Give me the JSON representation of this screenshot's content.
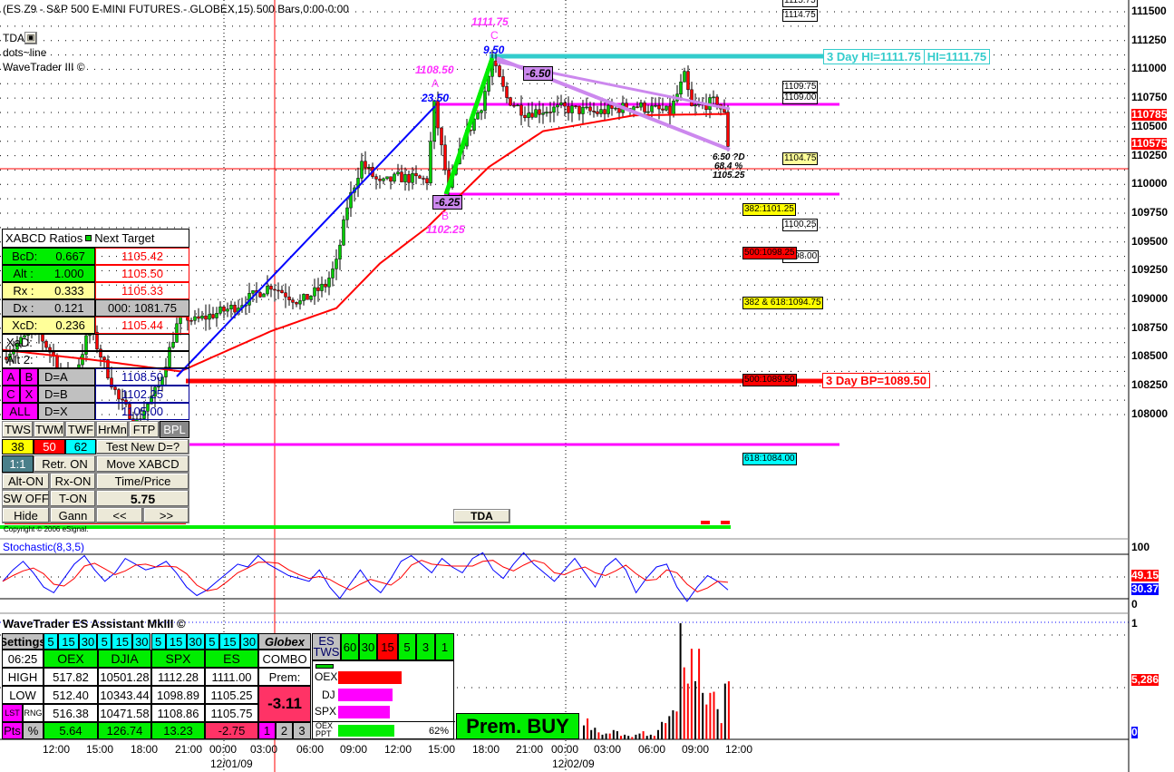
{
  "header": {
    "title": "(ES Z9 - S&P 500 E-MINI FUTURES - GLOBEX,15) 500 Bars,0:00-0:00",
    "tda": "TDA",
    "dots": "dots~line",
    "wavetrader": "WaveTrader III ©"
  },
  "colors": {
    "up": "#00cc00",
    "down": "#ff0000",
    "ma": "#ff0000",
    "abLine": "#0000ff",
    "bcLine": "#00ee00",
    "cdLine": "#cc88ee"
  },
  "price_axis": [
    "111500",
    "111250",
    "111000",
    "110750",
    "110500",
    "110250",
    "110000",
    "109750",
    "109500",
    "109250",
    "109000",
    "108750",
    "108500",
    "108250",
    "108000"
  ],
  "price_badges": {
    "last1": "110785",
    "last2": "110575"
  },
  "pattern": {
    "a_price": "1108.50",
    "a_label": "A",
    "a_move": "23.50",
    "b_price": "1102.25",
    "b_label": "B",
    "b_move": "-6.25",
    "c_price": "1111.75",
    "c_label": "C",
    "c_move": "9.50",
    "cd_move": "-6.50",
    "d_line1": "6.50 ?D",
    "d_line2": "68.4 %",
    "d_line3": "1105.25"
  },
  "levels": {
    "l1": "1115.75",
    "l2": "1114.75",
    "hi3": "3 Day HI=1111.75",
    "hi": "HI=1111.75",
    "l3": "1109.75",
    "l4": "1109.00",
    "l5": "1104.75",
    "f382": "382:1101.25",
    "l6": "1100.25",
    "f500": "500:1098.25",
    "l7": "1098.00",
    "f382618": "382 & 618:1094.75",
    "f500b": "500:1089.50",
    "bp3": "3 Day BP=1089.50",
    "f618": "618:1084.00"
  },
  "xabcd": {
    "title": "XABCD Ratios",
    "next": "Next Target",
    "rows": [
      {
        "k": "BcD:",
        "v": "0.667",
        "t": "1105.42"
      },
      {
        "k": "Alt  :",
        "v": "1.000",
        "t": "1105.50"
      },
      {
        "k": "Rx   :",
        "v": "0.333",
        "t": "1105.33"
      },
      {
        "k": "Dx   :",
        "v": "0.121",
        "t": "000: 1081.75"
      },
      {
        "k": "XcD:",
        "v": "0.236",
        "t": "1105.44"
      },
      {
        "k": "XaD:",
        "v": "",
        "t": ""
      },
      {
        "k": "Alt 2:",
        "v": "",
        "t": ""
      }
    ],
    "abcd": {
      "a": "A",
      "b": "B",
      "c": "C",
      "x": "X",
      "all": "ALL",
      "da": "D=A",
      "db": "D=B",
      "dx": "D=X",
      "ta": "1108.50",
      "tb": "1102.25",
      "tx": "1105.00"
    },
    "buttons": {
      "tws": "TWS",
      "twm": "TWM",
      "twf": "TWF",
      "hrmn": "HrMn",
      "ftp": "FTP",
      "bpl": "BPL",
      "f38": "38",
      "f50": "50",
      "f62": "62",
      "test": "Test New D=?",
      "ratio": "1:1",
      "retr": "Retr. ON",
      "move": "Move XABCD",
      "alt": "Alt-ON",
      "rx": "Rx-ON",
      "tp": "Time/Price",
      "sw": "SW OFF",
      "ton": "T-ON",
      "val": "5.75",
      "hide": "Hide",
      "gann": "Gann",
      "prev": "<<",
      "next": ">>"
    },
    "copyright": "Copyright © 2006 eSignal."
  },
  "tda_button": "TDA",
  "stoch": {
    "title": "Stochastic(8,3,5)",
    "axis_top": "100",
    "axis_bottom": "0",
    "k_val": "49.15",
    "d_val": "30.37",
    "k": [
      40,
      60,
      75,
      55,
      30,
      20,
      45,
      70,
      85,
      60,
      40,
      55,
      80,
      70,
      60,
      65,
      75,
      55,
      30,
      15,
      25,
      40,
      55,
      70,
      65,
      85,
      70,
      60,
      50,
      45,
      40,
      60,
      30,
      10,
      35,
      60,
      35,
      20,
      45,
      75,
      85,
      70,
      55,
      80,
      65,
      55,
      80,
      90,
      60,
      45,
      70,
      90,
      70,
      55,
      40,
      60,
      80,
      55,
      30,
      65,
      80,
      60,
      20,
      45,
      65,
      70,
      30,
      5,
      30,
      50,
      40,
      25
    ]
  },
  "volume": {
    "axis_top": "1",
    "axis_bottom": "0",
    "badge": "5,286",
    "values": [
      0.12,
      0.18,
      0.08,
      0.1,
      0.06,
      0.04,
      0.05,
      0.05,
      0.08,
      0.07,
      0.03,
      0.04,
      0.03,
      0.02,
      0.04,
      0.05,
      0.07,
      0.03,
      0.04,
      0.03,
      0.08,
      0.15,
      0.14,
      0.2,
      0.25,
      0.24,
      1.0,
      0.62,
      0.48,
      0.78,
      0.5,
      0.78,
      0.4,
      0.3,
      0.4,
      0.41,
      0.26,
      0.14,
      0.48,
      0.5
    ]
  },
  "assistant": {
    "title": "WaveTrader ES Assistant MkIII ©",
    "settings": "Settings",
    "time": "06:25",
    "globex": "Globex",
    "combo": "COMBO",
    "prem": "Prem:",
    "prem_val": "-3.11",
    "tf": [
      "5",
      "15",
      "30"
    ],
    "cols": [
      "OEX",
      "DJIA",
      "SPX",
      "ES"
    ],
    "rows": [
      {
        "label": "HIGH",
        "vals": [
          "517.82",
          "10501.28",
          "1112.28",
          "1111.00"
        ]
      },
      {
        "label": "LOW",
        "vals": [
          "512.40",
          "10343.44",
          "1098.89",
          "1105.25"
        ]
      },
      {
        "label": "LST",
        "label2": "RNG",
        "vals": [
          "516.38",
          "10471.58",
          "1108.86",
          "1105.75"
        ]
      },
      {
        "label": "Pts",
        "label2": "%",
        "vals": [
          "5.64",
          "126.74",
          "13.23",
          "-2.75"
        ]
      }
    ],
    "pages": [
      "1",
      "2",
      "3"
    ],
    "es_tws": "ES TWS",
    "tws_tf": [
      "60",
      "30",
      "15",
      "5",
      "3",
      "1"
    ],
    "bars": [
      {
        "name": "OEX",
        "pct": 0.82,
        "color": "#ff0000"
      },
      {
        "name": "DJ",
        "pct": 0.7,
        "color": "#ff00ff"
      },
      {
        "name": "SPX",
        "pct": 0.66,
        "color": "#ff00ff"
      },
      {
        "name": "OEX PPT",
        "pct": 0.72,
        "color": "#00ee00"
      }
    ],
    "ppt_pct": "62%",
    "signal": "Prem. BUY"
  },
  "time_axis": [
    {
      "t": "12:00"
    },
    {
      "t": "15:00"
    },
    {
      "t": "18:00"
    },
    {
      "t": "21:00"
    },
    {
      "t": "00:00",
      "d": "12/01/09"
    },
    {
      "t": "03:00"
    },
    {
      "t": "06:00"
    },
    {
      "t": "09:00"
    },
    {
      "t": "12:00"
    },
    {
      "t": "15:00"
    },
    {
      "t": "18:00"
    },
    {
      "t": "21:00"
    },
    {
      "t": "00:00",
      "d": "12/02/09"
    },
    {
      "t": "03:00"
    },
    {
      "t": "06:00"
    },
    {
      "t": "09:00"
    },
    {
      "t": "12:00"
    }
  ],
  "chart_data": {
    "type": "candlestick",
    "price_keypoints": [
      [
        0,
        1091
      ],
      [
        9,
        1093
      ],
      [
        19,
        1089
      ],
      [
        24,
        1093
      ],
      [
        32,
        1088
      ],
      [
        37,
        1086.5
      ],
      [
        43,
        1089
      ],
      [
        49,
        1094
      ],
      [
        53,
        1093.5
      ],
      [
        64,
        1094.5
      ],
      [
        74,
        1096
      ],
      [
        82,
        1094.8
      ],
      [
        89,
        1096
      ],
      [
        92,
        1097.5
      ],
      [
        95,
        1101.5
      ],
      [
        99,
        1104.5
      ],
      [
        104,
        1103
      ],
      [
        109,
        1103.5
      ],
      [
        117,
        1103.3
      ],
      [
        119,
        1108.5
      ],
      [
        122,
        1104
      ],
      [
        123,
        1102.5
      ],
      [
        127,
        1106
      ],
      [
        132,
        1108.5
      ],
      [
        135,
        1111.5
      ],
      [
        139,
        1109
      ],
      [
        144,
        1108
      ],
      [
        154,
        1108.3
      ],
      [
        164,
        1108
      ],
      [
        174,
        1108.5
      ],
      [
        184,
        1108
      ],
      [
        188,
        1110.5
      ],
      [
        190,
        1108.3
      ],
      [
        197,
        1108.8
      ],
      [
        199,
        1107.8
      ],
      [
        200,
        1105.8
      ]
    ],
    "ma_keypoints": [
      [
        0,
        1091.5
      ],
      [
        25,
        1090.8
      ],
      [
        49,
        1090
      ],
      [
        74,
        1092.8
      ],
      [
        92,
        1094.4
      ],
      [
        104,
        1097.5
      ],
      [
        117,
        1100
      ],
      [
        134,
        1104.2
      ],
      [
        149,
        1106.7
      ],
      [
        174,
        1107.8
      ],
      [
        200,
        1107.9
      ]
    ]
  }
}
